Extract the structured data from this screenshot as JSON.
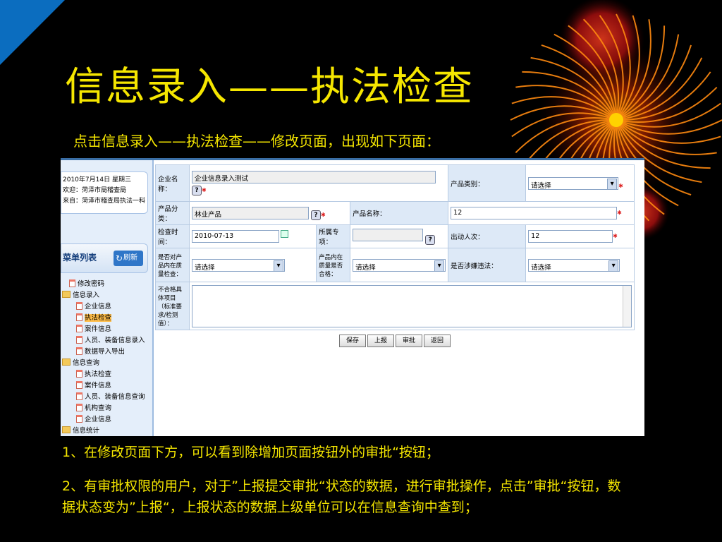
{
  "slide": {
    "title": "信息录入——执法检查",
    "subtitle": "点击信息录入——执法检查——修改页面，出现如下页面：",
    "notes": [
      "1、在修改页面下方，可以看到除增加页面按钮外的审批“按钮；",
      "2、有审批权限的用户，对于”上报提交审批“状态的数据，进行审批操作，点击”审批“按钮，数据状态变为”上报“，上报状态的数据上级单位可以在信息查询中查到；"
    ]
  },
  "sidebar": {
    "user_lines": [
      "2010年7月14日 星期三",
      "欢迎：菏泽市局稽查局",
      "来自：菏泽市稽查局执法一科"
    ],
    "menu_title": "菜单列表",
    "refresh_label": "刷新",
    "tree": [
      {
        "label": "修改密码",
        "level": 1,
        "type": "page"
      },
      {
        "label": "信息录入",
        "level": 0,
        "type": "folder"
      },
      {
        "label": "企业信息",
        "level": 2,
        "type": "page"
      },
      {
        "label": "执法检查",
        "level": 2,
        "type": "page",
        "selected": true
      },
      {
        "label": "案件信息",
        "level": 2,
        "type": "page"
      },
      {
        "label": "人员、装备信息录入",
        "level": 2,
        "type": "page"
      },
      {
        "label": "数据导入导出",
        "level": 2,
        "type": "page"
      },
      {
        "label": "信息查询",
        "level": 0,
        "type": "folder"
      },
      {
        "label": "执法检查",
        "level": 2,
        "type": "page"
      },
      {
        "label": "案件信息",
        "level": 2,
        "type": "page"
      },
      {
        "label": "人员、装备信息查询",
        "level": 2,
        "type": "page"
      },
      {
        "label": "机构查询",
        "level": 2,
        "type": "page"
      },
      {
        "label": "企业信息",
        "level": 2,
        "type": "page"
      },
      {
        "label": "信息统计",
        "level": 0,
        "type": "folder"
      }
    ]
  },
  "form": {
    "company_name_label": "企业名称：",
    "company_name_value": "企业信息录入测试",
    "product_category_label": "产品类别：",
    "product_category_value": "请选择",
    "product_class_label": "产品分类：",
    "product_class_value": "林业产品",
    "product_name_label": "产品名称：",
    "product_name_value": "12",
    "check_time_label": "检查时间：",
    "check_time_value": "2010-07-13",
    "special_label": "所属专项：",
    "special_value": "",
    "staff_count_label": "出动人次：",
    "staff_count_value": "12",
    "quality_check_label": "是否对产品内在质量检查：",
    "quality_check_value": "请选择",
    "quality_ok_label": "产品内在质量是否合格：",
    "quality_ok_value": "请选择",
    "illegal_label": "是否涉嫌违法：",
    "illegal_value": "请选择",
    "nonconform_label": "不合格具体项目（标准要求/检测值）：",
    "nonconform_value": "",
    "buttons": {
      "save": "保存",
      "report": "上报",
      "approve": "审批",
      "back": "返回"
    }
  }
}
